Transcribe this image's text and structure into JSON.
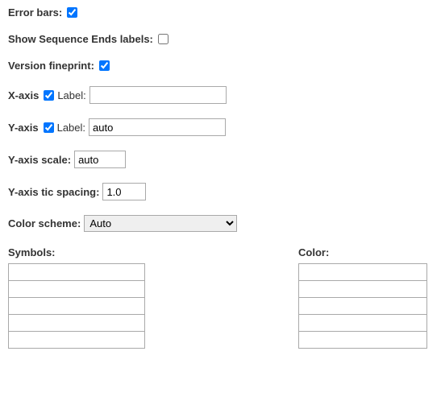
{
  "errorBars": {
    "label": "Error bars:",
    "checked": true
  },
  "seqEnds": {
    "label": "Show Sequence Ends labels:",
    "checked": false
  },
  "fineprint": {
    "label": "Version fineprint:",
    "checked": true
  },
  "xaxis": {
    "label": "X-axis",
    "checked": true,
    "sublabel": "Label:",
    "value": ""
  },
  "yaxis": {
    "label": "Y-axis",
    "checked": true,
    "sublabel": "Label:",
    "value": "auto"
  },
  "yscale": {
    "label": "Y-axis scale:",
    "value": "auto"
  },
  "ytic": {
    "label": "Y-axis tic spacing:",
    "value": "1.0"
  },
  "scheme": {
    "label": "Color scheme:",
    "selected": "Auto"
  },
  "symbols": {
    "header": "Symbols:",
    "rows": [
      "",
      "",
      "",
      "",
      ""
    ]
  },
  "colors": {
    "header": "Color:",
    "rows": [
      "",
      "",
      "",
      "",
      ""
    ]
  }
}
